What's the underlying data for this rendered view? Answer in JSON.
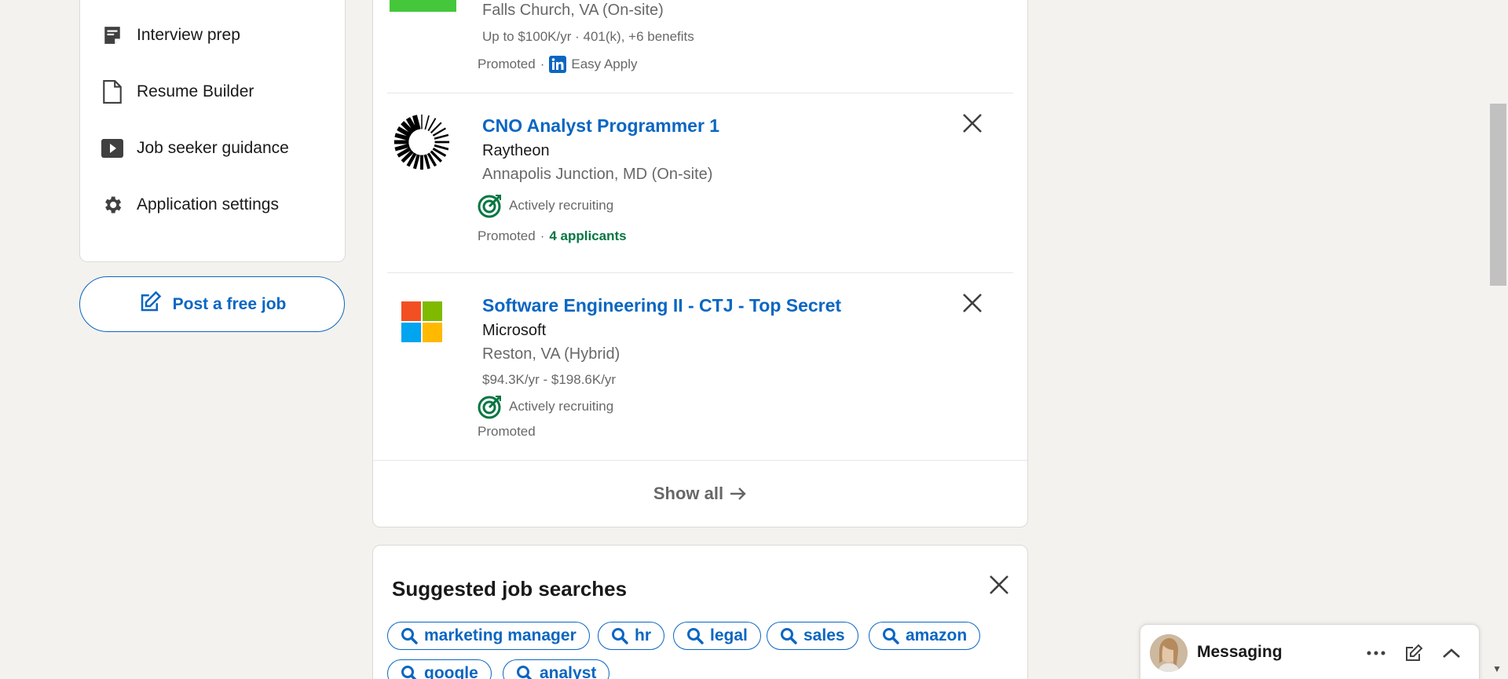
{
  "sidebar": {
    "items": [
      {
        "label": "Interview prep",
        "icon": "notepad-icon"
      },
      {
        "label": "Resume Builder",
        "icon": "document-icon"
      },
      {
        "label": "Job seeker guidance",
        "icon": "video-play-icon"
      },
      {
        "label": "Application settings",
        "icon": "gear-icon"
      }
    ],
    "post_job_label": "Post a free job"
  },
  "jobs": {
    "top_partial": {
      "location": "Falls Church, VA (On-site)",
      "salary": "Up to $100K/yr · 401(k), +6 benefits",
      "promoted": "Promoted",
      "dot": "·",
      "easy_apply": "Easy Apply"
    },
    "items": [
      {
        "title": "CNO Analyst Programmer 1",
        "company": "Raytheon",
        "location": "Annapolis Junction, MD (On-site)",
        "flag": "Actively recruiting",
        "promoted": "Promoted",
        "dot": "·",
        "applicants": "4 applicants"
      },
      {
        "title": "Software Engineering II - CTJ - Top Secret",
        "company": "Microsoft",
        "location": "Reston, VA (Hybrid)",
        "salary": "$94.3K/yr - $198.6K/yr",
        "flag": "Actively recruiting",
        "promoted": "Promoted"
      }
    ],
    "show_all_label": "Show all"
  },
  "suggested": {
    "title": "Suggested job searches",
    "pills": [
      "marketing manager",
      "hr",
      "legal",
      "sales",
      "amazon",
      "google",
      "analyst"
    ]
  },
  "messaging": {
    "label": "Messaging"
  },
  "colors": {
    "brand_blue": "#0a66c2",
    "green": "#057642",
    "background": "#f4f2ee"
  }
}
